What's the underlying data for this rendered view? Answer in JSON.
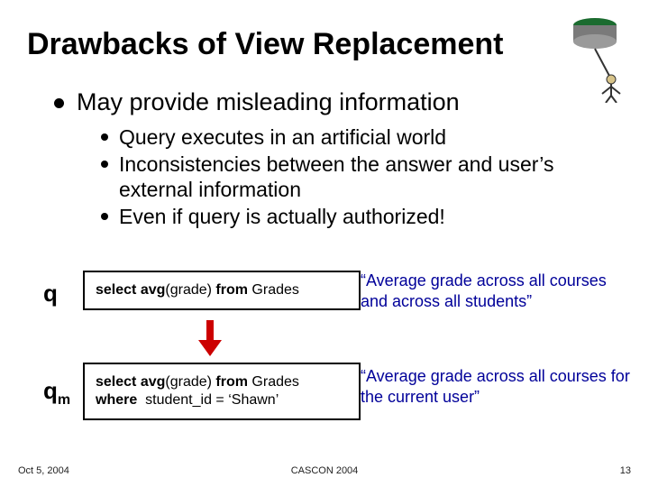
{
  "title": "Drawbacks of View Replacement",
  "main_bullet": "May provide misleading information",
  "sub_bullets": [
    "Query executes in an artificial world",
    "Inconsistencies between the answer and user’s external information",
    "Even if query is actually authorized!"
  ],
  "row1": {
    "label": "q",
    "code_html": "select avg(grade) from Grades",
    "quote": "“Average grade across all courses and across all students”"
  },
  "row2": {
    "label_main": "q",
    "label_sub": "m",
    "code_line1": "select avg(grade) from Grades",
    "code_line2": "where  student_id = ‘Shawn’",
    "quote": "“Average grade across all courses for the current user”"
  },
  "footer": {
    "left": "Oct 5, 2004",
    "center": "CASCON 2004",
    "right": "13"
  }
}
